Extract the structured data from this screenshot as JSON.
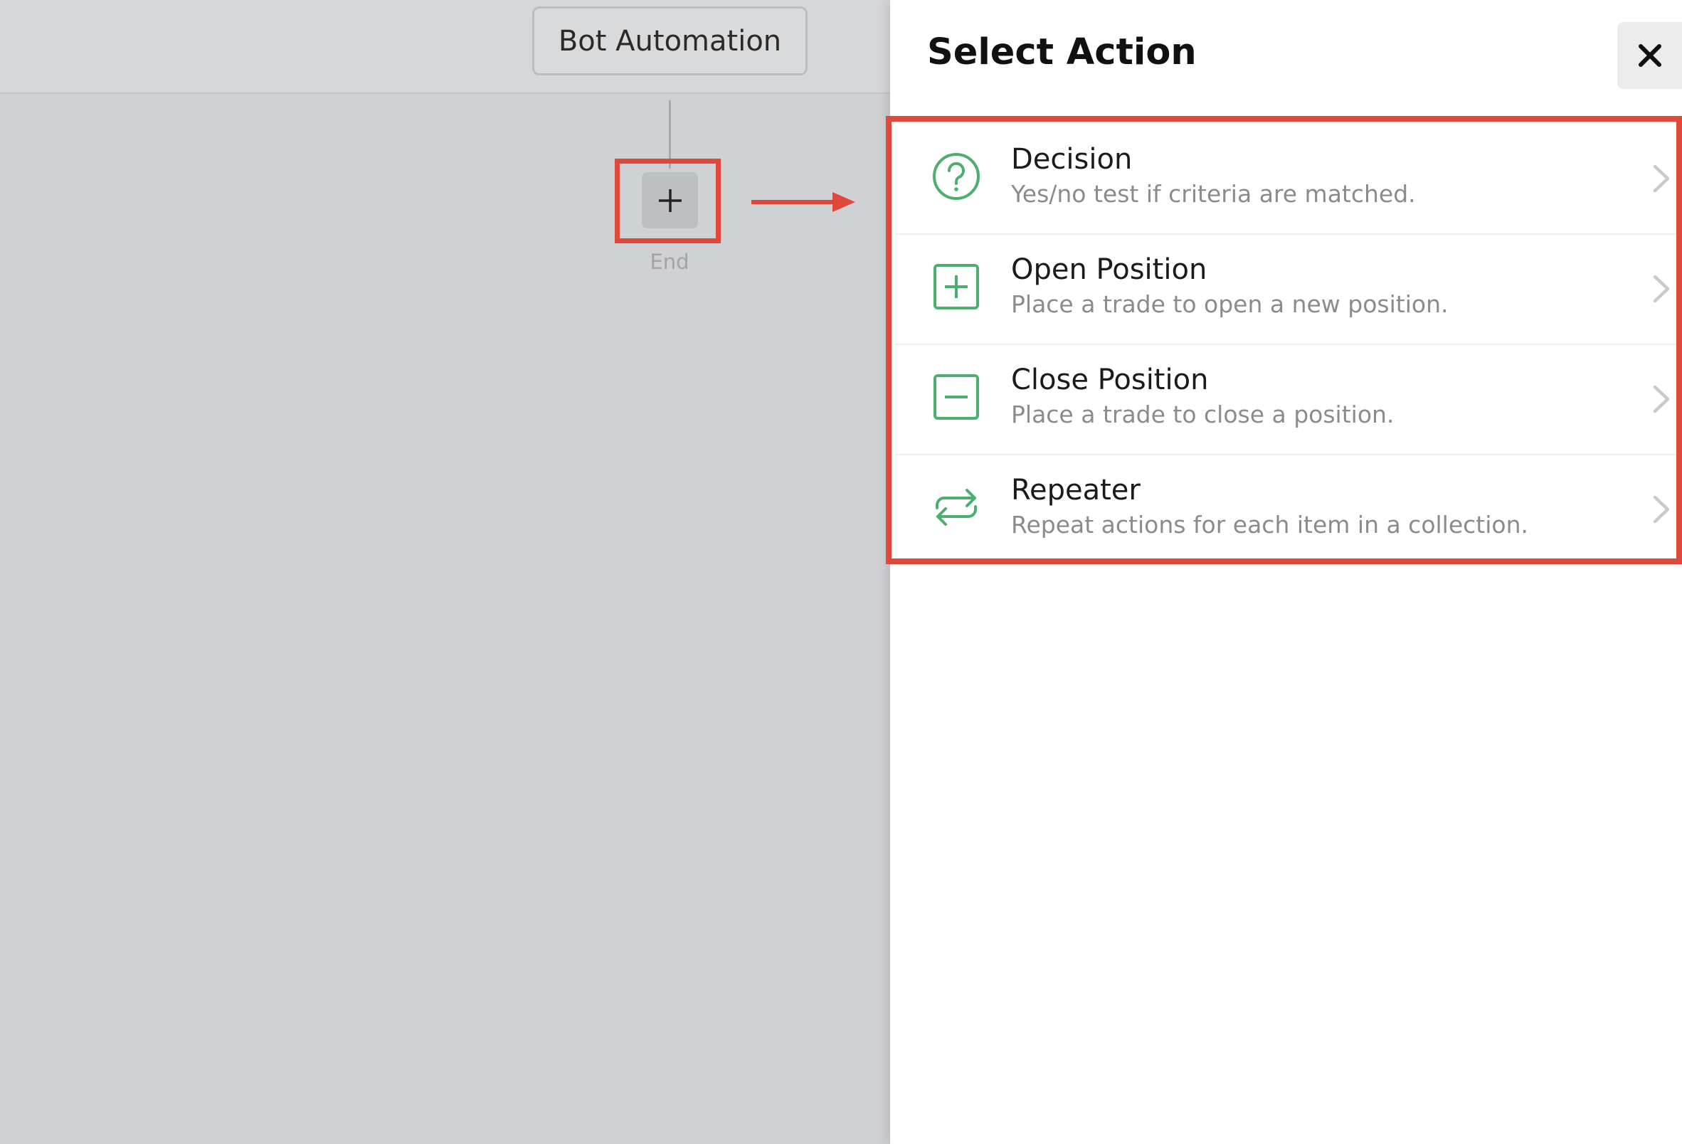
{
  "canvas": {
    "node_label": "Bot Automation",
    "add_icon": "plus-icon",
    "end_label": "End",
    "annotation_color": "#e0483c"
  },
  "panel": {
    "title": "Select Action",
    "close_icon": "close-icon",
    "accent_color": "#4caf6d",
    "actions": [
      {
        "name": "Decision",
        "description": "Yes/no test if criteria are matched.",
        "icon": "question-circle-icon"
      },
      {
        "name": "Open Position",
        "description": "Place a trade to open a new position.",
        "icon": "plus-square-icon"
      },
      {
        "name": "Close Position",
        "description": "Place a trade to close a position.",
        "icon": "minus-square-icon"
      },
      {
        "name": "Repeater",
        "description": "Repeat actions for each item in a collection.",
        "icon": "repeat-icon"
      }
    ]
  }
}
